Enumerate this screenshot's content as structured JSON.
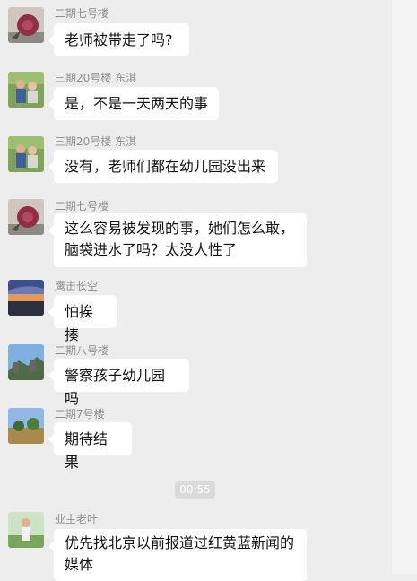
{
  "messages": [
    {
      "sender": "二期七号楼",
      "text": "老师被带走了吗?",
      "avatar": "flower-avatar"
    },
    {
      "sender": "三期20号楼 东淇",
      "text": "是，不是一天两天的事",
      "avatar": "family-photo-avatar"
    },
    {
      "sender": "三期20号楼 东淇",
      "text": "没有，老师们都在幼儿园没出来",
      "avatar": "family-photo-avatar"
    },
    {
      "sender": "二期七号楼",
      "text_line1": "这么容易被发现的事，她们怎么敢，",
      "text_line2": "脑袋进水了吗？太没人性了",
      "avatar": "flower-avatar"
    },
    {
      "sender": "鹰击长空",
      "text": "怕挨揍",
      "avatar": "sunset-sky-avatar"
    },
    {
      "sender": "二期八号楼",
      "text": "警察孩子幼儿园吗",
      "avatar": "great-wall-avatar"
    },
    {
      "sender": "二期7号楼",
      "text": "期待结果",
      "avatar": "landscape-avatar"
    },
    {
      "sender": "业主老叶",
      "text_line1": "优先找北京以前报道过红黄蓝新闻的",
      "text_line2": "媒体",
      "avatar": "person-outdoor-avatar"
    }
  ],
  "timestamp": "00:55",
  "colors": {
    "background": "#ededed",
    "bubble": "#ffffff",
    "sender_text": "#8f8f8f",
    "time_chip": "#dadada"
  }
}
